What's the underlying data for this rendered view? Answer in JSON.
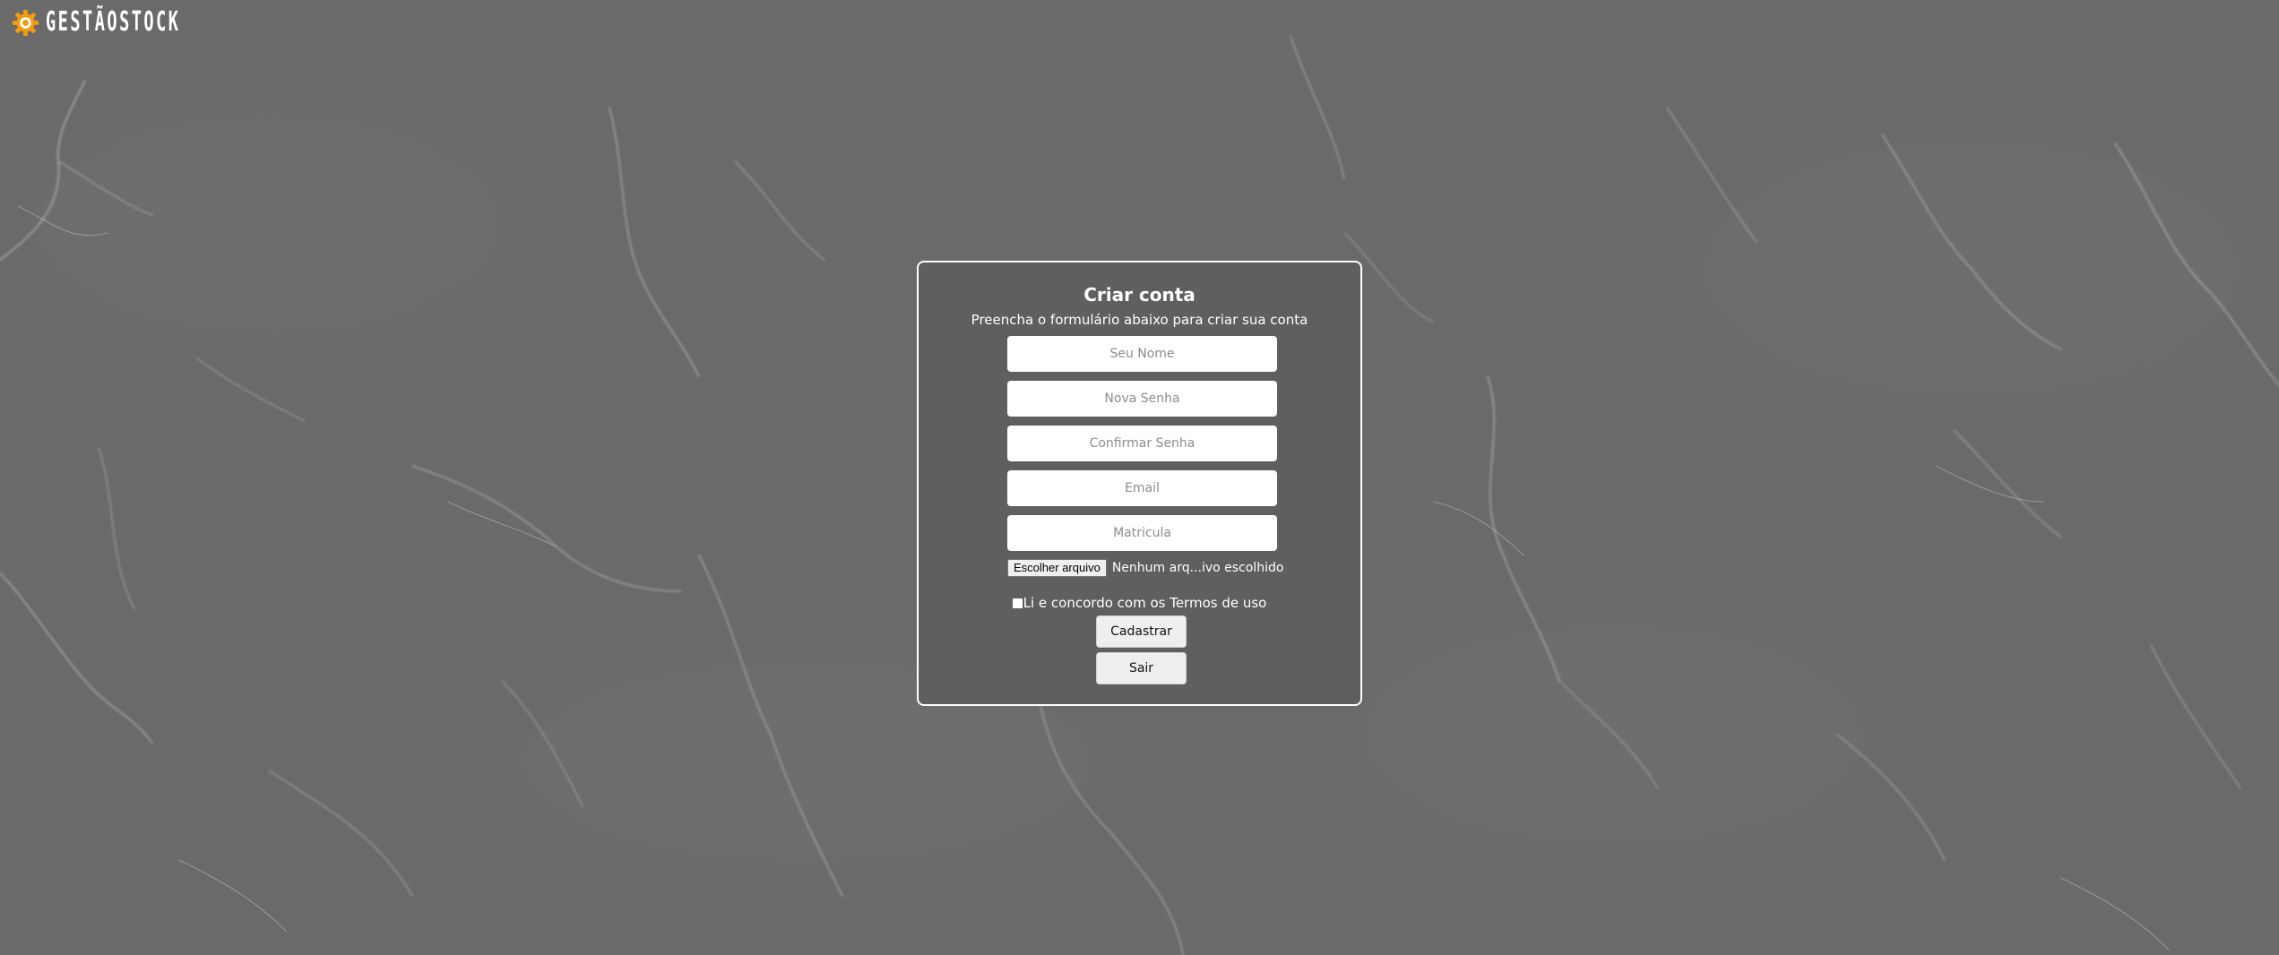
{
  "brand": {
    "name": "GESTÃOSTOCK",
    "icon": "gear-icon",
    "icon_color": "#f39c12"
  },
  "form": {
    "title": "Criar conta",
    "subtitle": "Preencha o formulário abaixo para criar sua conta",
    "fields": {
      "name": {
        "value": "",
        "placeholder": "Seu Nome"
      },
      "new_password": {
        "value": "",
        "placeholder": "Nova Senha"
      },
      "confirm_password": {
        "value": "",
        "placeholder": "Confirmar Senha"
      },
      "email": {
        "value": "",
        "placeholder": "Email"
      },
      "registration": {
        "value": "",
        "placeholder": "Matricula"
      }
    },
    "file_upload": {
      "button_label": "Escolher arquivo",
      "status": "Nenhum arq...ivo escolhido"
    },
    "terms": {
      "label": "Li e concordo com os Termos de uso",
      "checked": false
    },
    "submit_label": "Cadastrar",
    "exit_label": "Sair"
  },
  "colors": {
    "background": "#6a6a6a",
    "card_background": "#5f5f5f",
    "card_border": "#ffffff"
  }
}
